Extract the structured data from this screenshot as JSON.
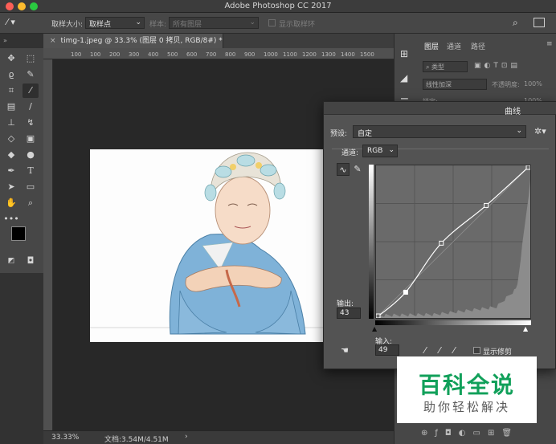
{
  "window": {
    "title": "Adobe Photoshop CC 2017",
    "traffic_colors": [
      "#fc5f57",
      "#fdbc2e",
      "#2ac940"
    ]
  },
  "options_bar": {
    "sample_size_label": "取样大小:",
    "sample_size_value": "取样点",
    "sample_label": "样本:",
    "sample_value": "所有图层",
    "show_ring_label": "显示取样环"
  },
  "document": {
    "tab_title": "timg-1.jpeg @ 33.3% (图层 0 拷贝, RGB/8#) *",
    "ruler_ticks": [
      "100",
      "100",
      "200",
      "300",
      "400",
      "500",
      "600",
      "700",
      "800",
      "900",
      "1000",
      "1100",
      "1200",
      "1300",
      "1400",
      "1500"
    ]
  },
  "status": {
    "zoom": "33.33%",
    "doc_size": "文档:3.54M/4.51M",
    "arrow": "›"
  },
  "panels": {
    "tabs": [
      "图层",
      "通道",
      "路径"
    ],
    "filter_placeholder": "类型",
    "blend_mode": "线性加深",
    "opacity_label": "不透明度:",
    "opacity_value": "100%",
    "lock_label": "锁定:",
    "fill_value": "100%"
  },
  "curves": {
    "title": "曲线",
    "preset_label": "预设:",
    "preset_value": "自定",
    "channel_label": "通道:",
    "channel_value": "RGB",
    "output_label": "输出:",
    "output_value": "43",
    "input_label": "输入:",
    "input_value": "49",
    "show_clipping_label": "显示修剪",
    "curve_points": [
      [
        0,
        0
      ],
      [
        49,
        43
      ],
      [
        108,
        125
      ],
      [
        182,
        188
      ],
      [
        255,
        255
      ]
    ],
    "histogram_color": "#8c8c8c"
  },
  "watermark": {
    "main": "百科全说",
    "sub": "助你轻松解决",
    "color": "#11a05a"
  }
}
